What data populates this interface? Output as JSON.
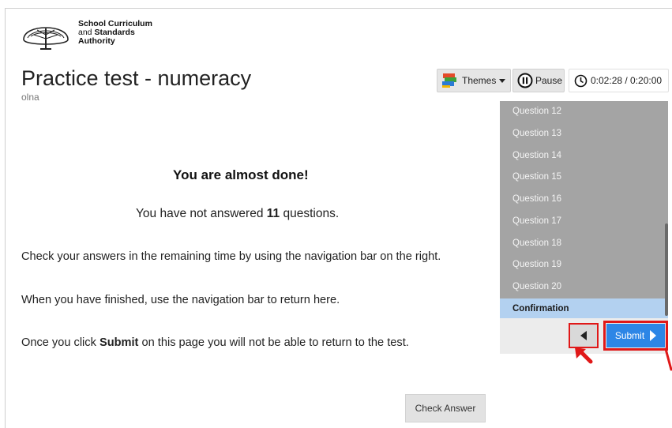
{
  "header": {
    "org_line1": "School Curriculum",
    "org_line2_prefix": "and",
    "org_line2_bold": "Standards",
    "org_line3": "Authority"
  },
  "page": {
    "title": "Practice test - numeracy",
    "subtitle": "olna"
  },
  "toolbar": {
    "themes_label": "Themes",
    "pause_label": "Pause",
    "timer": "0:02:28 / 0:20:00"
  },
  "main": {
    "heading": "You are almost done!",
    "not_answered_prefix": "You have not answered",
    "not_answered_count": "11",
    "not_answered_suffix": "questions.",
    "line1": "Check your answers in the remaining time by using the navigation bar on the right.",
    "line2": "When you have finished, use the navigation bar to return here.",
    "line3_prefix": "Once you click",
    "line3_bold": "Submit",
    "line3_suffix": "on this page you will not be able to return to the test.",
    "check_answer_label": "Check Answer"
  },
  "nav": {
    "items": [
      {
        "label": "Question 12"
      },
      {
        "label": "Question 13"
      },
      {
        "label": "Question 14"
      },
      {
        "label": "Question 15"
      },
      {
        "label": "Question 16"
      },
      {
        "label": "Question 17"
      },
      {
        "label": "Question 18"
      },
      {
        "label": "Question 19"
      },
      {
        "label": "Question 20"
      },
      {
        "label": "Confirmation"
      }
    ],
    "active_label": "Confirmation",
    "submit_label": "Submit"
  },
  "colors": {
    "nav_background": "#a4a4a4",
    "nav_active": "#b3d1f0",
    "submit_blue": "#2d86e6",
    "highlight_red": "#e01818"
  },
  "icons": {
    "logo": "tree-logo-icon",
    "themes": "palette-icon",
    "pause": "pause-circle-icon",
    "timer": "clock-icon",
    "back": "triangle-left-icon",
    "submit": "triangle-right-icon",
    "annotation": "red-arrow-icon"
  }
}
